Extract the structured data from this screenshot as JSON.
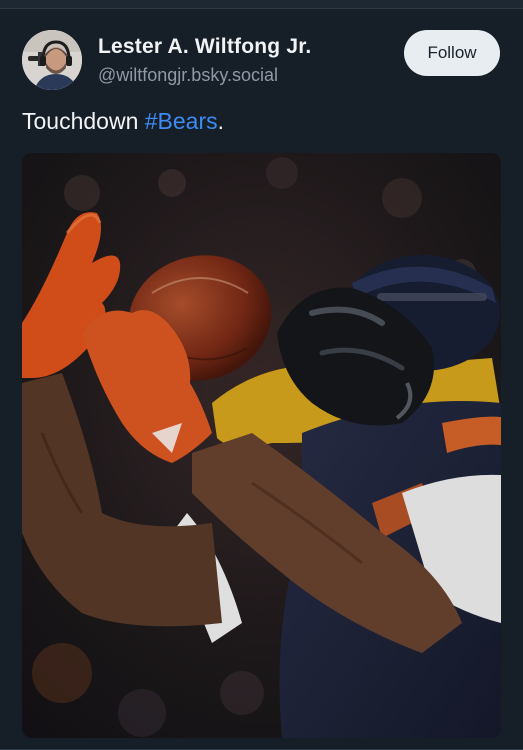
{
  "post": {
    "author": {
      "display_name": "Lester A. Wiltfong Jr.",
      "handle": "@wiltfongjr.bsky.social"
    },
    "follow_label": "Follow",
    "text": "Touchdown ",
    "hashtag": "#Bears",
    "text_suffix": ".",
    "media": {
      "icon": "photo"
    }
  },
  "colors": {
    "background": "#161e27",
    "accent": "#3d8bf5",
    "follow_button_bg": "#e8edf2"
  }
}
